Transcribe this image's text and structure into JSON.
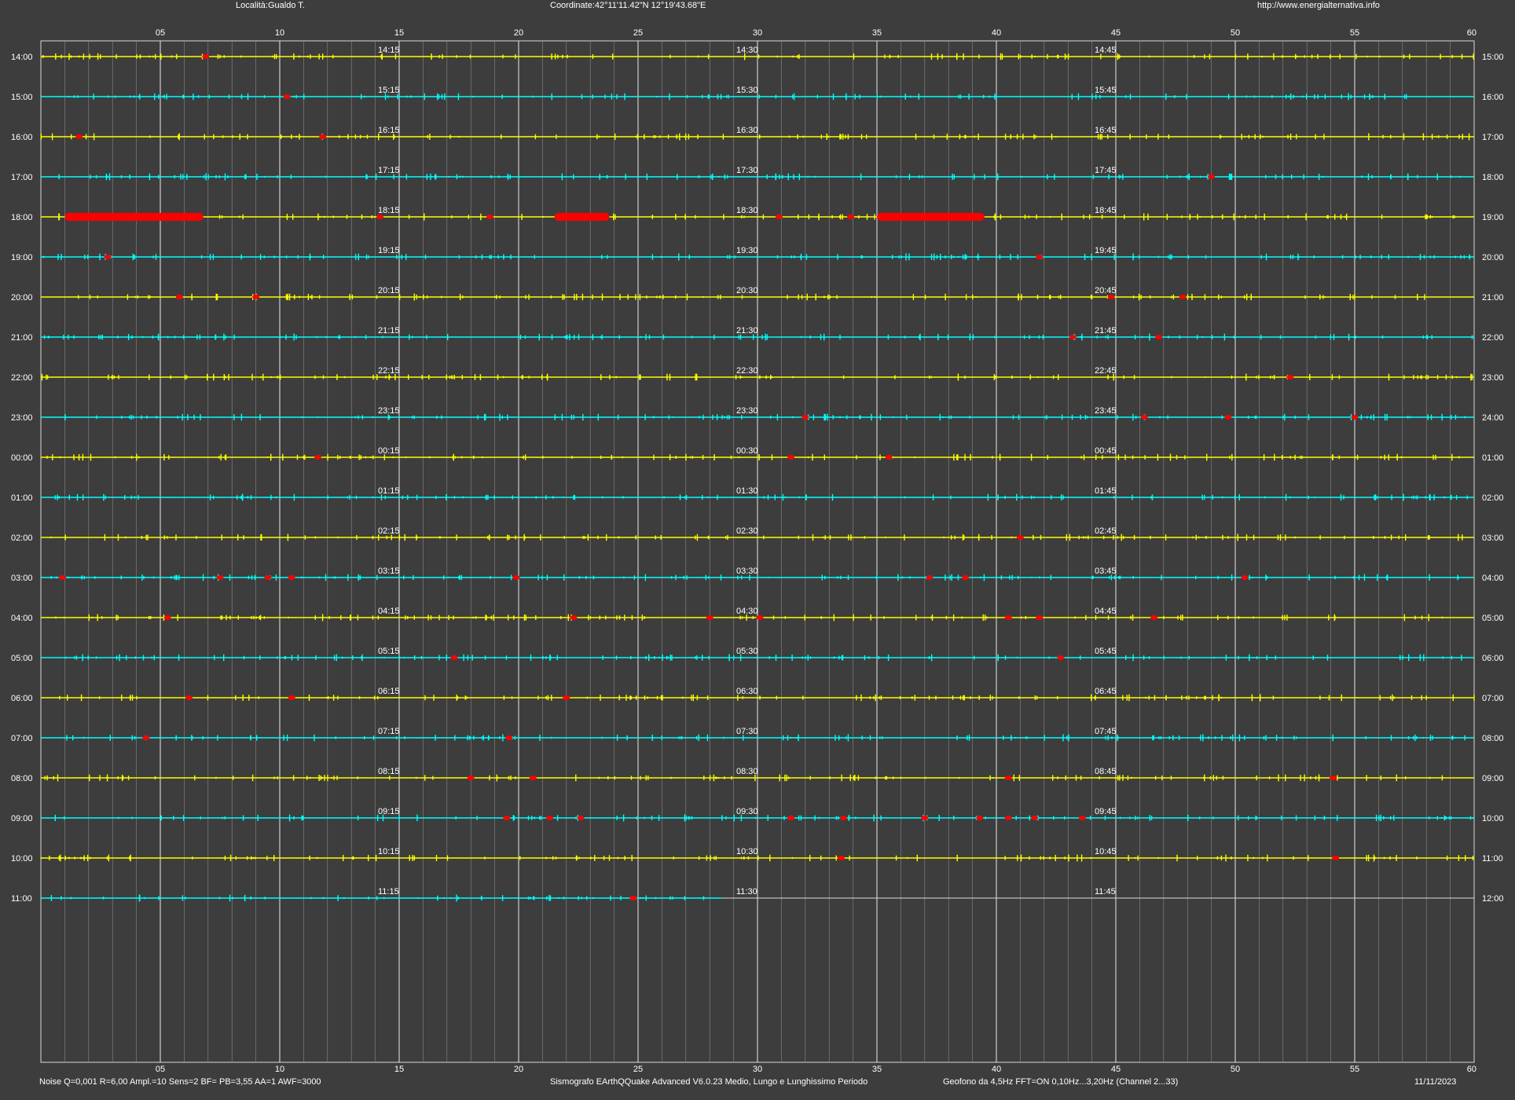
{
  "header": {
    "location": "Località:Gualdo T.",
    "coordinates": "Coordinate:42°11'11.42\"N  12°19'43.68\"E",
    "url": "http://www.energialternativa.info"
  },
  "footer": {
    "params": "Noise Q=0,001 R=6,00 Ampl.=10 Sens=2 BF= PB=3,55 AA=1 AWF=3000",
    "software": "Sismografo  EArthQQuake Advanced V6.0.23  Medio, Lungo e Lunghissimo Periodo",
    "sensor": "Geofono da 4,5Hz FFT=ON 0,10Hz...3,20Hz      (Channel 2...33)",
    "date": "11/11/2023"
  },
  "colors": {
    "background": "#3d3d3d",
    "trace_a": "#ffff00",
    "trace_b": "#00ffff",
    "event": "#ff0000",
    "grid": "#d9d9d9",
    "text": "#ffffff"
  },
  "chart_data": {
    "type": "line",
    "title": "",
    "x_ticks": [
      "05",
      "10",
      "15",
      "20",
      "25",
      "30",
      "35",
      "40",
      "45",
      "50",
      "55",
      "60"
    ],
    "xlim": [
      0,
      60
    ],
    "rows": [
      {
        "left": "14:00",
        "right": "15:00",
        "marks": [
          "14:15",
          "14:30",
          "14:45"
        ]
      },
      {
        "left": "15:00",
        "right": "16:00",
        "marks": [
          "15:15",
          "15:30",
          "15:45"
        ]
      },
      {
        "left": "16:00",
        "right": "17:00",
        "marks": [
          "16:15",
          "16:30",
          "16:45"
        ]
      },
      {
        "left": "17:00",
        "right": "18:00",
        "marks": [
          "17:15",
          "17:30",
          "17:45"
        ]
      },
      {
        "left": "18:00",
        "right": "19:00",
        "marks": [
          "18:15",
          "18:30",
          "18:45"
        ]
      },
      {
        "left": "19:00",
        "right": "20:00",
        "marks": [
          "19:15",
          "19:30",
          "19:45"
        ]
      },
      {
        "left": "20:00",
        "right": "21:00",
        "marks": [
          "20:15",
          "20:30",
          "20:45"
        ]
      },
      {
        "left": "21:00",
        "right": "22:00",
        "marks": [
          "21:15",
          "21:30",
          "21:45"
        ]
      },
      {
        "left": "22:00",
        "right": "23:00",
        "marks": [
          "22:15",
          "22:30",
          "22:45"
        ]
      },
      {
        "left": "23:00",
        "right": "24:00",
        "marks": [
          "23:15",
          "23:30",
          "23:45"
        ]
      },
      {
        "left": "00:00",
        "right": "01:00",
        "marks": [
          "00:15",
          "00:30",
          "00:45"
        ]
      },
      {
        "left": "01:00",
        "right": "02:00",
        "marks": [
          "01:15",
          "01:30",
          "01:45"
        ]
      },
      {
        "left": "02:00",
        "right": "03:00",
        "marks": [
          "02:15",
          "02:30",
          "02:45"
        ]
      },
      {
        "left": "03:00",
        "right": "04:00",
        "marks": [
          "03:15",
          "03:30",
          "03:45"
        ]
      },
      {
        "left": "04:00",
        "right": "05:00",
        "marks": [
          "04:15",
          "04:30",
          "04:45"
        ]
      },
      {
        "left": "05:00",
        "right": "06:00",
        "marks": [
          "05:15",
          "05:30",
          "05:45"
        ]
      },
      {
        "left": "06:00",
        "right": "07:00",
        "marks": [
          "06:15",
          "06:30",
          "06:45"
        ]
      },
      {
        "left": "07:00",
        "right": "08:00",
        "marks": [
          "07:15",
          "07:30",
          "07:45"
        ]
      },
      {
        "left": "08:00",
        "right": "09:00",
        "marks": [
          "08:15",
          "08:30",
          "08:45"
        ]
      },
      {
        "left": "09:00",
        "right": "10:00",
        "marks": [
          "09:15",
          "09:30",
          "09:45"
        ]
      },
      {
        "left": "10:00",
        "right": "11:00",
        "marks": [
          "10:15",
          "10:30",
          "10:45"
        ]
      },
      {
        "left": "11:00",
        "right": "12:00",
        "marks": [
          "11:15",
          "11:30",
          "11:45"
        ]
      }
    ],
    "recording_end_minute": 28.5,
    "events": [
      {
        "row": 0,
        "minute": 6.9
      },
      {
        "row": 1,
        "minute": 10.3
      },
      {
        "row": 2,
        "minute": 1.6
      },
      {
        "row": 2,
        "minute": 11.8
      },
      {
        "row": 3,
        "minute": 49.0
      },
      {
        "row": 4,
        "minute": 1.0,
        "to": 6.8
      },
      {
        "row": 4,
        "minute": 14.2
      },
      {
        "row": 4,
        "minute": 18.8
      },
      {
        "row": 4,
        "minute": 21.5,
        "to": 23.8
      },
      {
        "row": 4,
        "minute": 30.9
      },
      {
        "row": 4,
        "minute": 33.9
      },
      {
        "row": 4,
        "minute": 35.0,
        "to": 39.5
      },
      {
        "row": 5,
        "minute": 2.8
      },
      {
        "row": 5,
        "minute": 41.8
      },
      {
        "row": 6,
        "minute": 5.8
      },
      {
        "row": 6,
        "minute": 9.0
      },
      {
        "row": 6,
        "minute": 44.8
      },
      {
        "row": 6,
        "minute": 47.8
      },
      {
        "row": 7,
        "minute": 43.2
      },
      {
        "row": 7,
        "minute": 46.8
      },
      {
        "row": 8,
        "minute": 52.3
      },
      {
        "row": 9,
        "minute": 32.0
      },
      {
        "row": 9,
        "minute": 46.2
      },
      {
        "row": 9,
        "minute": 49.7
      },
      {
        "row": 9,
        "minute": 55.0
      },
      {
        "row": 10,
        "minute": 11.6
      },
      {
        "row": 10,
        "minute": 31.4
      },
      {
        "row": 10,
        "minute": 35.5
      },
      {
        "row": 12,
        "minute": 41.0
      },
      {
        "row": 13,
        "minute": 0.9
      },
      {
        "row": 13,
        "minute": 7.5
      },
      {
        "row": 13,
        "minute": 9.5
      },
      {
        "row": 13,
        "minute": 10.5
      },
      {
        "row": 13,
        "minute": 19.9
      },
      {
        "row": 13,
        "minute": 37.2
      },
      {
        "row": 13,
        "minute": 38.7
      },
      {
        "row": 13,
        "minute": 50.4
      },
      {
        "row": 14,
        "minute": 5.3
      },
      {
        "row": 14,
        "minute": 22.3
      },
      {
        "row": 14,
        "minute": 28.0
      },
      {
        "row": 14,
        "minute": 30.1
      },
      {
        "row": 14,
        "minute": 40.5
      },
      {
        "row": 14,
        "minute": 41.8
      },
      {
        "row": 14,
        "minute": 46.6
      },
      {
        "row": 15,
        "minute": 17.3
      },
      {
        "row": 15,
        "minute": 42.7
      },
      {
        "row": 16,
        "minute": 6.2
      },
      {
        "row": 16,
        "minute": 10.5
      },
      {
        "row": 16,
        "minute": 22.0
      },
      {
        "row": 17,
        "minute": 4.4
      },
      {
        "row": 17,
        "minute": 19.6
      },
      {
        "row": 18,
        "minute": 18.0
      },
      {
        "row": 18,
        "minute": 20.6
      },
      {
        "row": 18,
        "minute": 40.5
      },
      {
        "row": 18,
        "minute": 54.1
      },
      {
        "row": 19,
        "minute": 19.5
      },
      {
        "row": 19,
        "minute": 21.3
      },
      {
        "row": 19,
        "minute": 22.6
      },
      {
        "row": 19,
        "minute": 31.4
      },
      {
        "row": 19,
        "minute": 33.6
      },
      {
        "row": 19,
        "minute": 37.0
      },
      {
        "row": 19,
        "minute": 39.3
      },
      {
        "row": 19,
        "minute": 40.5
      },
      {
        "row": 19,
        "minute": 41.6
      },
      {
        "row": 19,
        "minute": 43.6
      },
      {
        "row": 20,
        "minute": 33.5
      },
      {
        "row": 20,
        "minute": 54.2
      },
      {
        "row": 21,
        "minute": 24.8
      }
    ]
  }
}
